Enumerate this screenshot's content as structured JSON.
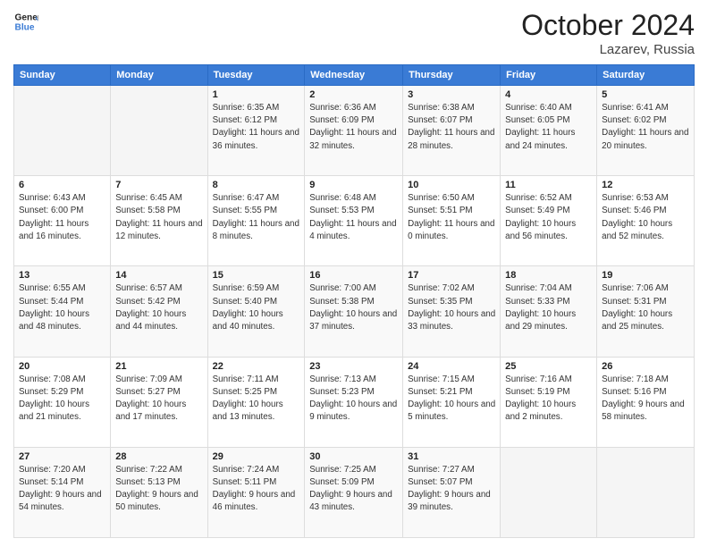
{
  "header": {
    "logo_line1": "General",
    "logo_line2": "Blue",
    "month": "October 2024",
    "location": "Lazarev, Russia"
  },
  "weekdays": [
    "Sunday",
    "Monday",
    "Tuesday",
    "Wednesday",
    "Thursday",
    "Friday",
    "Saturday"
  ],
  "weeks": [
    [
      {
        "day": "",
        "info": ""
      },
      {
        "day": "",
        "info": ""
      },
      {
        "day": "1",
        "info": "Sunrise: 6:35 AM\nSunset: 6:12 PM\nDaylight: 11 hours and 36 minutes."
      },
      {
        "day": "2",
        "info": "Sunrise: 6:36 AM\nSunset: 6:09 PM\nDaylight: 11 hours and 32 minutes."
      },
      {
        "day": "3",
        "info": "Sunrise: 6:38 AM\nSunset: 6:07 PM\nDaylight: 11 hours and 28 minutes."
      },
      {
        "day": "4",
        "info": "Sunrise: 6:40 AM\nSunset: 6:05 PM\nDaylight: 11 hours and 24 minutes."
      },
      {
        "day": "5",
        "info": "Sunrise: 6:41 AM\nSunset: 6:02 PM\nDaylight: 11 hours and 20 minutes."
      }
    ],
    [
      {
        "day": "6",
        "info": "Sunrise: 6:43 AM\nSunset: 6:00 PM\nDaylight: 11 hours and 16 minutes."
      },
      {
        "day": "7",
        "info": "Sunrise: 6:45 AM\nSunset: 5:58 PM\nDaylight: 11 hours and 12 minutes."
      },
      {
        "day": "8",
        "info": "Sunrise: 6:47 AM\nSunset: 5:55 PM\nDaylight: 11 hours and 8 minutes."
      },
      {
        "day": "9",
        "info": "Sunrise: 6:48 AM\nSunset: 5:53 PM\nDaylight: 11 hours and 4 minutes."
      },
      {
        "day": "10",
        "info": "Sunrise: 6:50 AM\nSunset: 5:51 PM\nDaylight: 11 hours and 0 minutes."
      },
      {
        "day": "11",
        "info": "Sunrise: 6:52 AM\nSunset: 5:49 PM\nDaylight: 10 hours and 56 minutes."
      },
      {
        "day": "12",
        "info": "Sunrise: 6:53 AM\nSunset: 5:46 PM\nDaylight: 10 hours and 52 minutes."
      }
    ],
    [
      {
        "day": "13",
        "info": "Sunrise: 6:55 AM\nSunset: 5:44 PM\nDaylight: 10 hours and 48 minutes."
      },
      {
        "day": "14",
        "info": "Sunrise: 6:57 AM\nSunset: 5:42 PM\nDaylight: 10 hours and 44 minutes."
      },
      {
        "day": "15",
        "info": "Sunrise: 6:59 AM\nSunset: 5:40 PM\nDaylight: 10 hours and 40 minutes."
      },
      {
        "day": "16",
        "info": "Sunrise: 7:00 AM\nSunset: 5:38 PM\nDaylight: 10 hours and 37 minutes."
      },
      {
        "day": "17",
        "info": "Sunrise: 7:02 AM\nSunset: 5:35 PM\nDaylight: 10 hours and 33 minutes."
      },
      {
        "day": "18",
        "info": "Sunrise: 7:04 AM\nSunset: 5:33 PM\nDaylight: 10 hours and 29 minutes."
      },
      {
        "day": "19",
        "info": "Sunrise: 7:06 AM\nSunset: 5:31 PM\nDaylight: 10 hours and 25 minutes."
      }
    ],
    [
      {
        "day": "20",
        "info": "Sunrise: 7:08 AM\nSunset: 5:29 PM\nDaylight: 10 hours and 21 minutes."
      },
      {
        "day": "21",
        "info": "Sunrise: 7:09 AM\nSunset: 5:27 PM\nDaylight: 10 hours and 17 minutes."
      },
      {
        "day": "22",
        "info": "Sunrise: 7:11 AM\nSunset: 5:25 PM\nDaylight: 10 hours and 13 minutes."
      },
      {
        "day": "23",
        "info": "Sunrise: 7:13 AM\nSunset: 5:23 PM\nDaylight: 10 hours and 9 minutes."
      },
      {
        "day": "24",
        "info": "Sunrise: 7:15 AM\nSunset: 5:21 PM\nDaylight: 10 hours and 5 minutes."
      },
      {
        "day": "25",
        "info": "Sunrise: 7:16 AM\nSunset: 5:19 PM\nDaylight: 10 hours and 2 minutes."
      },
      {
        "day": "26",
        "info": "Sunrise: 7:18 AM\nSunset: 5:16 PM\nDaylight: 9 hours and 58 minutes."
      }
    ],
    [
      {
        "day": "27",
        "info": "Sunrise: 7:20 AM\nSunset: 5:14 PM\nDaylight: 9 hours and 54 minutes."
      },
      {
        "day": "28",
        "info": "Sunrise: 7:22 AM\nSunset: 5:13 PM\nDaylight: 9 hours and 50 minutes."
      },
      {
        "day": "29",
        "info": "Sunrise: 7:24 AM\nSunset: 5:11 PM\nDaylight: 9 hours and 46 minutes."
      },
      {
        "day": "30",
        "info": "Sunrise: 7:25 AM\nSunset: 5:09 PM\nDaylight: 9 hours and 43 minutes."
      },
      {
        "day": "31",
        "info": "Sunrise: 7:27 AM\nSunset: 5:07 PM\nDaylight: 9 hours and 39 minutes."
      },
      {
        "day": "",
        "info": ""
      },
      {
        "day": "",
        "info": ""
      }
    ]
  ]
}
